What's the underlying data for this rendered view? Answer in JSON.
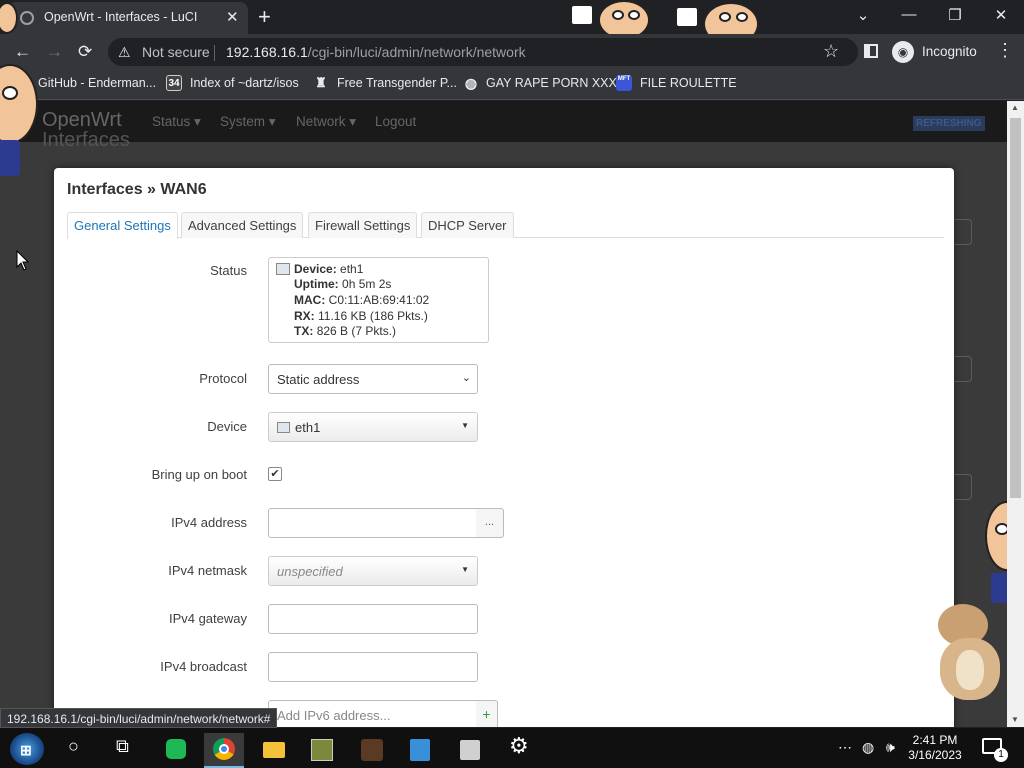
{
  "browser": {
    "tab_title": "OpenWrt - Interfaces - LuCI",
    "tab_close": "✕",
    "new_tab": "+",
    "win_min": "—",
    "win_restore": "❐",
    "win_close": "✕",
    "back": "←",
    "forward": "→",
    "reload": "⟳",
    "not_secure": "Not secure",
    "url_host": "192.168.16.1",
    "url_path": "/cgi-bin/luci/admin/network/network",
    "incognito": "Incognito",
    "menu": "⋮",
    "star": "☆",
    "bookmarks": [
      {
        "label": "GitHub - Enderman...",
        "icon": "github-icon"
      },
      {
        "label": "Index of ~dartz/isos",
        "icon": "index-icon",
        "badge": "34"
      },
      {
        "label": "Free Transgender P...",
        "icon": "bookmark-icon"
      },
      {
        "label": "GAY RAPE PORN XXX",
        "icon": "globe-icon"
      },
      {
        "label": "FILE ROULETTE",
        "icon": "file-icon",
        "badge": "MFT"
      }
    ],
    "status_url": "192.168.16.1/cgi-bin/luci/admin/network/network#"
  },
  "luci": {
    "brand": "OpenWrt",
    "menu": [
      "Status ▾",
      "System ▾",
      "Network ▾",
      "Logout"
    ],
    "refreshing": "REFRESHING",
    "behind_title": "Interfaces"
  },
  "modal": {
    "title": "Interfaces » WAN6",
    "tabs": [
      "General Settings",
      "Advanced Settings",
      "Firewall Settings",
      "DHCP Server"
    ],
    "status_label": "Status",
    "status": {
      "device_key": "Device:",
      "device": "eth1",
      "uptime_key": "Uptime:",
      "uptime": "0h 5m 2s",
      "mac_key": "MAC:",
      "mac": "C0:11:AB:69:41:02",
      "rx_key": "RX:",
      "rx": "11.16 KB (186 Pkts.)",
      "tx_key": "TX:",
      "tx": "826 B (7 Pkts.)"
    },
    "protocol_label": "Protocol",
    "protocol_value": "Static address",
    "device_label": "Device",
    "device_value": "eth1",
    "boot_label": "Bring up on boot",
    "boot_checked": true,
    "ipv4_address_label": "IPv4 address",
    "ipv4_address_addon": "...",
    "ipv4_netmask_label": "IPv4 netmask",
    "ipv4_netmask_value": "unspecified",
    "ipv4_gateway_label": "IPv4 gateway",
    "ipv4_broadcast_label": "IPv4 broadcast",
    "ipv6_placeholder": "Add IPv6 address...",
    "ipv6_add": "+"
  },
  "taskbar": {
    "time": "2:41 PM",
    "date": "3/16/2023",
    "notification_count": "1"
  },
  "colors": {
    "accent": "#1d74b8",
    "chrome_bg": "#202124",
    "chrome_toolbar": "#35363a"
  }
}
